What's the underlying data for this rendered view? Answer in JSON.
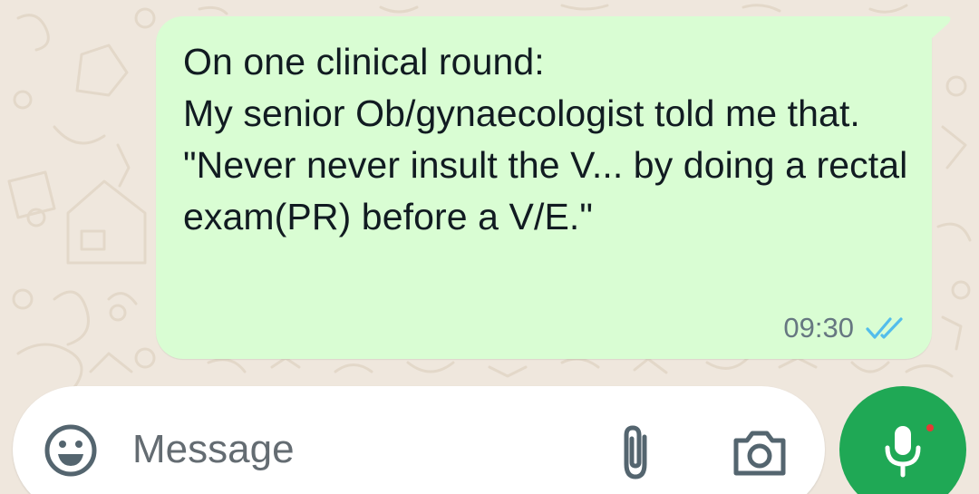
{
  "message": {
    "text": "On one clinical round:\nMy senior Ob/gynaecologist told me that.\n\"Never never insult the V... by doing a rectal exam(PR) before a V/E.\"",
    "time": "09:30",
    "status_icon": "double-check-read-icon",
    "status_color": "#53bdeb",
    "bubble_color": "#d9fdd3"
  },
  "composer": {
    "placeholder": "Message",
    "value": "",
    "emoji_icon": "emoji-icon",
    "attach_icon": "paperclip-icon",
    "camera_icon": "camera-icon",
    "mic_icon": "mic-icon",
    "mic_button_color": "#1fa855"
  },
  "theme": {
    "wallpaper_color": "#efe7dd"
  }
}
